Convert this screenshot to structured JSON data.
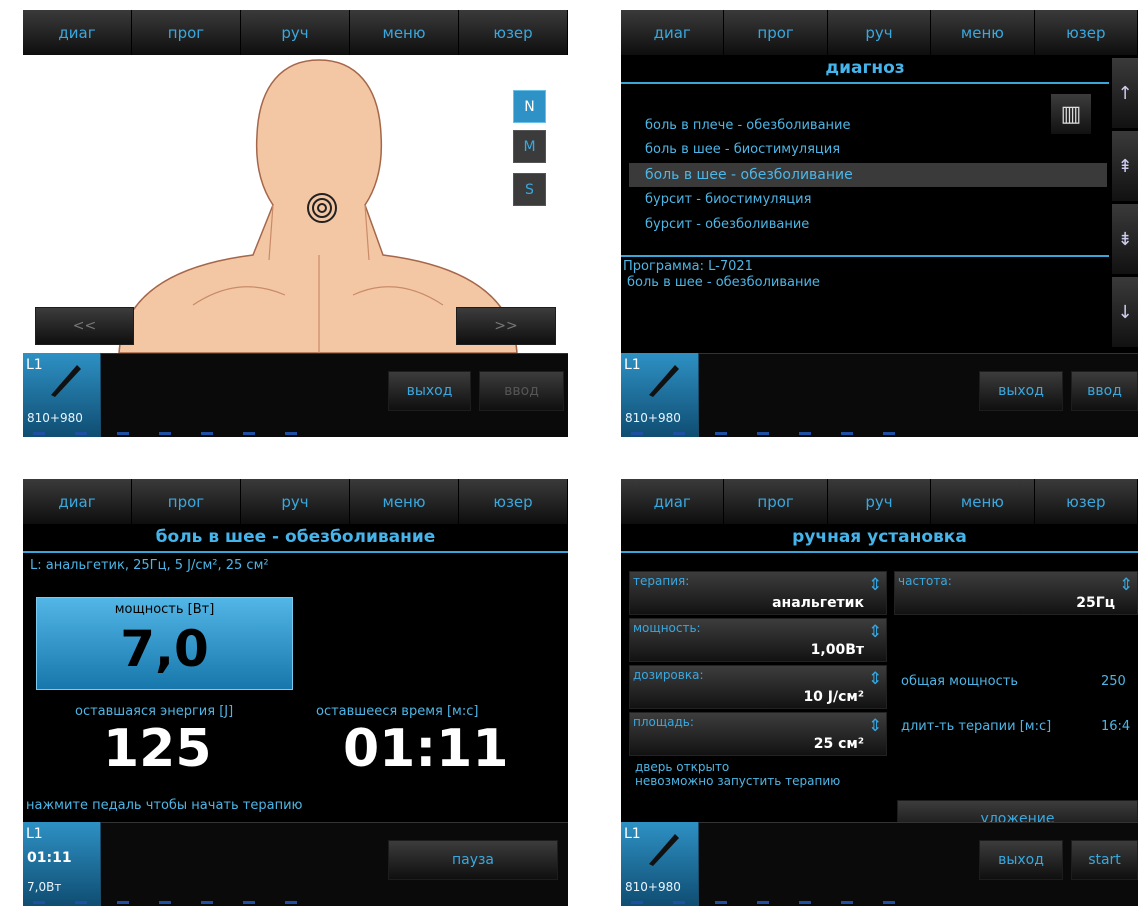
{
  "nav": [
    "диаг",
    "прог",
    "руч",
    "меню",
    "юзер"
  ],
  "screen1": {
    "sizes": [
      "N",
      "M",
      "S"
    ],
    "prev": "<<",
    "next": ">>",
    "exit": "выход",
    "enter": "ввод",
    "indicator": {
      "label": "L1",
      "value": "810+980"
    }
  },
  "screen2": {
    "title": "диагноз",
    "items": [
      "боль в плече - обезболивание",
      "боль в шее - биостимуляция",
      "боль в шее - обезболивание",
      "бурсит - биостимуляция",
      "бурсит - обезболивание"
    ],
    "selected_index": 2,
    "program_line1": "Программа: L-7021",
    "program_line2": "боль в шее - обезболивание",
    "exit": "выход",
    "enter": "ввод",
    "indicator": {
      "label": "L1",
      "value": "810+980"
    }
  },
  "screen3": {
    "title": "боль в шее - обезболивание",
    "subline": "L:   анальгетик, 25Гц, 5 J/см², 25 см²",
    "power_label": "мощность [Вт]",
    "power_value": "7,0",
    "energy_label": "оставшаяся энергия [J]",
    "energy_value": "125",
    "time_label": "оставшееся время  [м:с]",
    "time_value": "01:11",
    "hint": "нажмите педаль чтобы начать терапию",
    "pause": "пауза",
    "indicator": {
      "label": "L1",
      "time": "01:11",
      "power": "7,0Вт"
    }
  },
  "screen4": {
    "title": "ручная установка",
    "therapy_label": "терапия:",
    "therapy_value": "анальгетик",
    "power_label": "мощность:",
    "power_value": "1,00Вт",
    "dose_label": "дозировка:",
    "dose_value": "10 J/см²",
    "area_label": "площадь:",
    "area_value": "25 см²",
    "freq_label": "частота:",
    "freq_value": "25Гц",
    "total_power_label": "общая мощность",
    "total_power_value": "250",
    "duration_label": "длит-ть терапии [м:с]",
    "duration_value": "16:4",
    "door_line1": "дверь открыто",
    "door_line2": "невозможно запустить терапию",
    "layout_btn": "уложение",
    "exit": "выход",
    "start": "start",
    "indicator": {
      "label": "L1",
      "value": "810+980"
    }
  }
}
